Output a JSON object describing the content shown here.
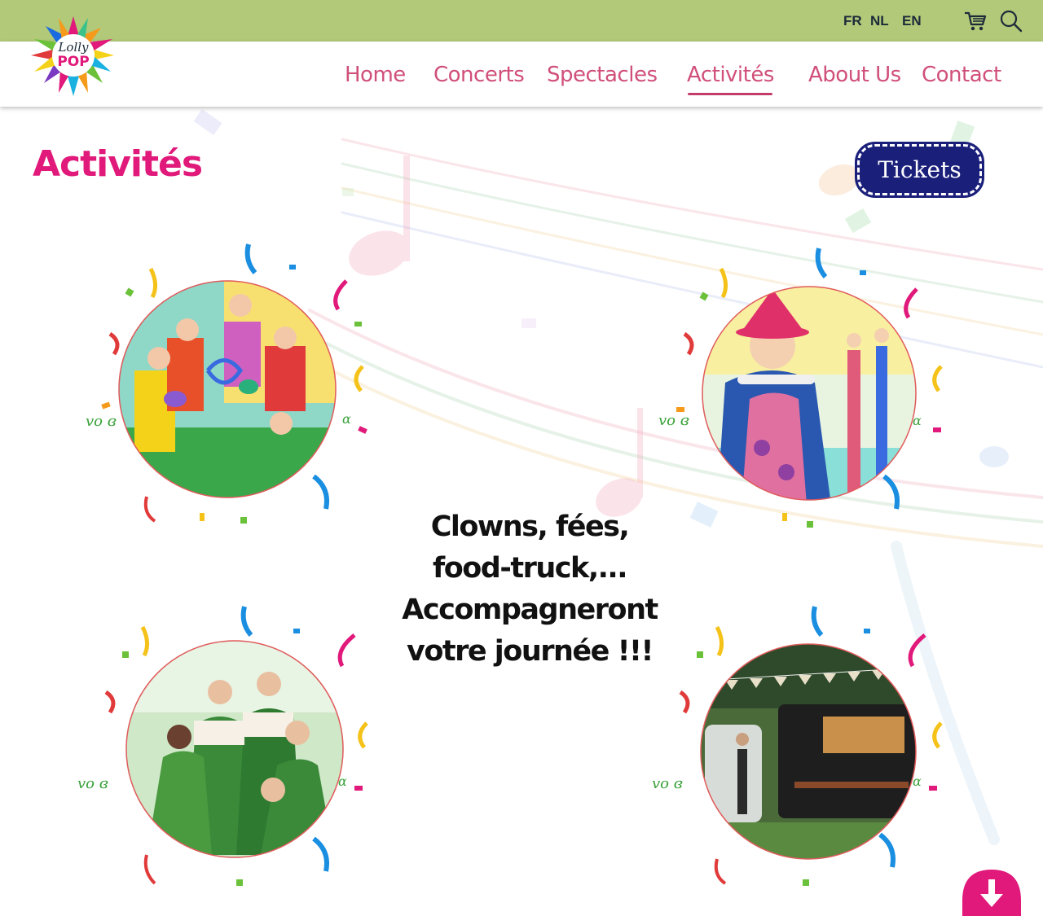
{
  "top_bar": {
    "languages": [
      "FR",
      "NL",
      "EN"
    ],
    "cart_icon": "cart-icon",
    "search_icon": "search-icon",
    "color": "#b1c978"
  },
  "logo": {
    "line1": "Lolly",
    "line2": "POP"
  },
  "nav": {
    "items": [
      "Home",
      "Concerts",
      "Spectacles",
      "Activités",
      "About Us",
      "Contact"
    ],
    "active": "Activités",
    "color": "#d0507a"
  },
  "page": {
    "title": "Activités",
    "title_color": "#e0197a",
    "tickets_label": "Tickets",
    "tickets_color": "#1a1f7a",
    "tagline": [
      "Clowns, fées,",
      "food-truck,...",
      "Accompagneront",
      "votre journée !!!"
    ]
  },
  "activities": [
    {
      "name": "clowns",
      "icon": "clowns-photo"
    },
    {
      "name": "clown-stilts",
      "icon": "clown-photo"
    },
    {
      "name": "fairies",
      "icon": "fairies-photo"
    },
    {
      "name": "food-truck",
      "icon": "food-truck-photo"
    }
  ],
  "scroll_button": {
    "icon": "arrow-down-icon",
    "color": "#e0197a"
  }
}
